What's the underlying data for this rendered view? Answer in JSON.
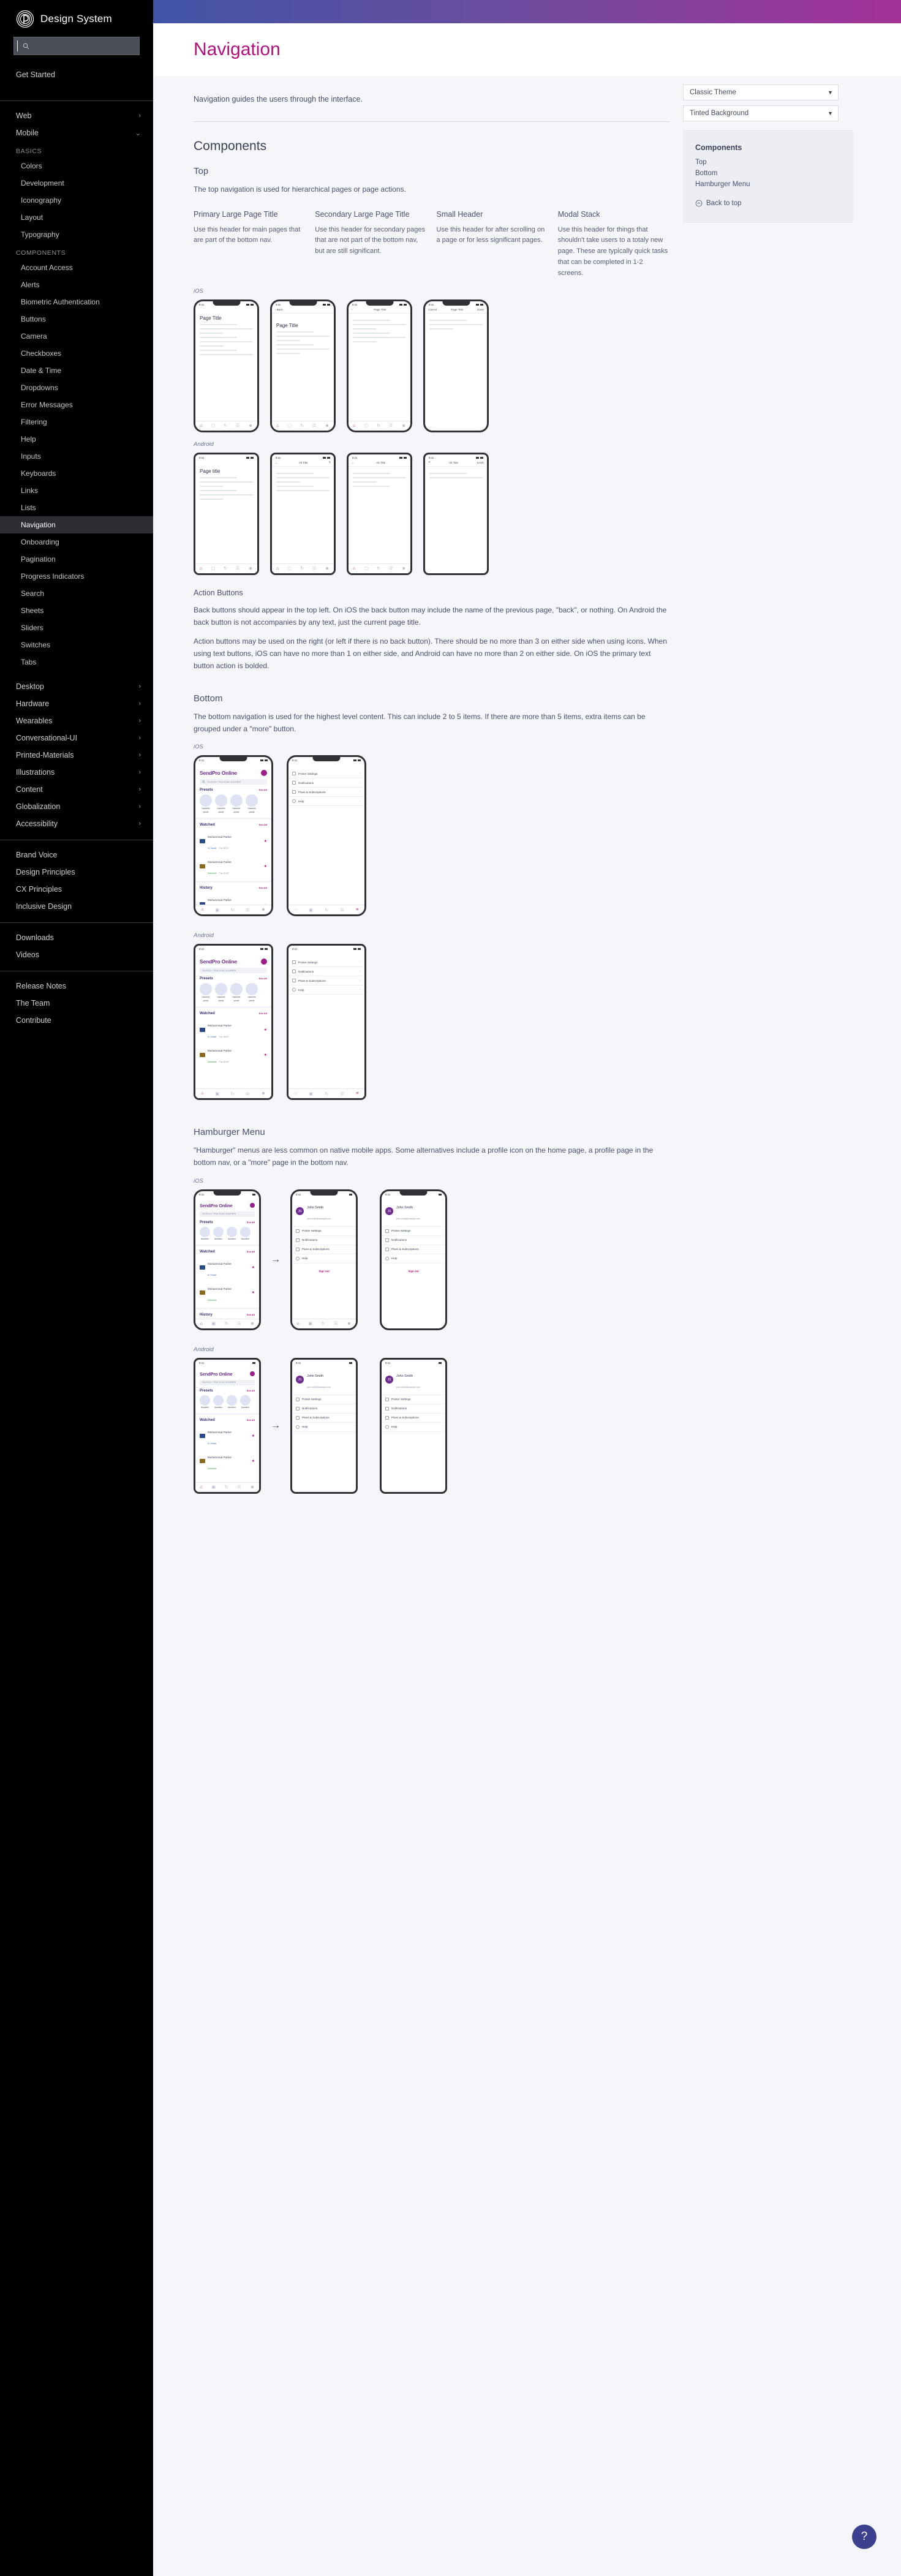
{
  "brand": {
    "name": "Design System",
    "logo_icon": "spiral-logo-icon"
  },
  "search": {
    "value": "",
    "placeholder": "",
    "icon": "search-icon"
  },
  "sidebar": {
    "get_started": "Get Started",
    "platforms": [
      {
        "label": "Web",
        "chevron": "chevron-right-icon"
      },
      {
        "label": "Mobile",
        "chevron": "chevron-down-icon"
      }
    ],
    "basics_label": "BASICS",
    "basics": [
      "Colors",
      "Development",
      "Iconography",
      "Layout",
      "Typography"
    ],
    "components_label": "COMPONENTS",
    "components": [
      "Account Access",
      "Alerts",
      "Biometric Authentication",
      "Buttons",
      "Camera",
      "Checkboxes",
      "Date & Time",
      "Dropdowns",
      "Error Messages",
      "Filtering",
      "Help",
      "Inputs",
      "Keyboards",
      "Links",
      "Lists",
      "Navigation",
      "Onboarding",
      "Pagination",
      "Progress Indicators",
      "Search",
      "Sheets",
      "Sliders",
      "Switches",
      "Tabs"
    ],
    "active_component": "Navigation",
    "more_platforms": [
      "Desktop",
      "Hardware",
      "Wearables",
      "Conversational-UI",
      "Printed-Materials",
      "Illustrations",
      "Content",
      "Globalization",
      "Accessibility"
    ],
    "principles": [
      "Brand Voice",
      "Design Principles",
      "CX Principles",
      "Inclusive Design"
    ],
    "resources": [
      "Downloads",
      "Videos"
    ],
    "about": [
      "Release Notes",
      "The Team",
      "Contribute"
    ]
  },
  "page": {
    "title": "Navigation",
    "intro": "Navigation guides the users through the interface.",
    "components_heading": "Components"
  },
  "rail": {
    "theme_select": "Classic Theme",
    "background_select": "Tinted Background",
    "title": "Components",
    "links": [
      "Top",
      "Bottom",
      "Hamburger Menu"
    ],
    "back_to_top": "Back to top",
    "back_to_top_icon": "circle-up-arrow-icon"
  },
  "top_section": {
    "heading": "Top",
    "intro": "The top navigation is used for hierarchical pages or page actions.",
    "cards": [
      {
        "title": "Primary Large Page Title",
        "desc": "Use this header for main pages that are part of the bottom nav."
      },
      {
        "title": "Secondary Large Page Title",
        "desc": "Use this header for secondary pages that are not part of the bottom nav, but are still significant."
      },
      {
        "title": "Small Header",
        "desc": "Use this header for after scrolling on a page or for less significant pages."
      },
      {
        "title": "Modal Stack",
        "desc": "Use this header for things that shouldn't take users to a totaly new page. These are typically quick tasks that can be completed in 1-2 screens."
      }
    ],
    "ios_label": "iOS",
    "android_label": "Android",
    "ios_phones": [
      {
        "title": "Page Title",
        "style": "large"
      },
      {
        "title": "Page Title",
        "style": "large-back"
      },
      {
        "title": "Page Title",
        "style": "small"
      },
      {
        "title": "Page Title",
        "style": "modal"
      }
    ],
    "android_phones": [
      {
        "title": "Page title",
        "style": "large"
      },
      {
        "title": "Alt Title",
        "style": "large-back"
      },
      {
        "title": "Alt Title",
        "style": "small"
      },
      {
        "title": "Alt Title",
        "style": "modal"
      }
    ]
  },
  "action_buttons": {
    "heading": "Action Buttons",
    "p1": "Back buttons should appear in the top left. On iOS the back button may include the name of the previous page, \"back\", or nothing. On Android the back button is not accompanies by any text, just the current page title.",
    "p2": "Action buttons may be used on the right (or left if there is no back button). There should be no more than 3 on either side when using icons. When using text buttons, iOS can have no more than 1 on either side, and Android can have no more than 2 on either side. On iOS the primary text button action is bolded."
  },
  "bottom_section": {
    "heading": "Bottom",
    "intro": "The bottom navigation is used for the highest level content. This can include 2 to 5 items. If there are more than 5 items, extra items can be grouped under a \"more\" button.",
    "ios_label": "iOS",
    "android_label": "Android"
  },
  "hamburger_section": {
    "heading": "Hamburger Menu",
    "intro": "\"Hamburger\" menus are less common on native mobile apps. Some alternatives include a profile icon on the home page, a profile page in the bottom nav, or a \"more\" page in the bottom nav.",
    "ios_label": "iOS",
    "android_label": "Android",
    "arrow_icon": "arrow-right-icon"
  },
  "app_mock": {
    "status_time": "9:41",
    "app_name": "SendPro Online",
    "search_placeholder": "SEARCH TRACKING NUMBER",
    "sections": [
      {
        "title": "Presets",
        "action": "See All"
      },
      {
        "title": "Watched",
        "action": "See All"
      },
      {
        "title": "History",
        "action": "See All"
      }
    ],
    "preset_label_line1": "Namethe",
    "preset_label_line2": "preset",
    "tracking": [
      {
        "name": "Muhammad Parker",
        "status": "In-Transit",
        "date": "Tue 10/15",
        "starred": true,
        "carrier": "usps"
      },
      {
        "name": "Muhammad Parker",
        "status": "Delivered",
        "date": "Tue 10/15",
        "starred": true,
        "carrier": "ups"
      },
      {
        "name": "Muhammad Parker",
        "status": "In-Transit",
        "date": "Tue 10/15",
        "starred": false,
        "carrier": "usps"
      }
    ],
    "menu_items": [
      {
        "label": "Printer Settings",
        "icon": "printer-icon"
      },
      {
        "label": "Notifications",
        "icon": "bell-icon"
      },
      {
        "label": "Plans & Subscriptions",
        "icon": "layers-icon"
      },
      {
        "label": "Help",
        "icon": "question-circle-icon"
      }
    ],
    "profile": {
      "initials": "JS",
      "name": "John Smith",
      "email": "john.smith@example.com"
    },
    "sign_out": "Sign out",
    "nav_icons": [
      "home-icon",
      "ship-icon",
      "history-icon",
      "card-icon",
      "contacts-icon"
    ],
    "nav_icons_alt": [
      "home-icon",
      "ship-icon",
      "history-icon",
      "card-icon",
      "hamburger-icon"
    ]
  },
  "help_button": {
    "label": "?",
    "icon": "question-mark-icon"
  },
  "colors": {
    "accent": "#b3107d",
    "brand_purple": "#6f2d91",
    "topbar_start": "#4054a6",
    "topbar_end": "#a33298"
  }
}
